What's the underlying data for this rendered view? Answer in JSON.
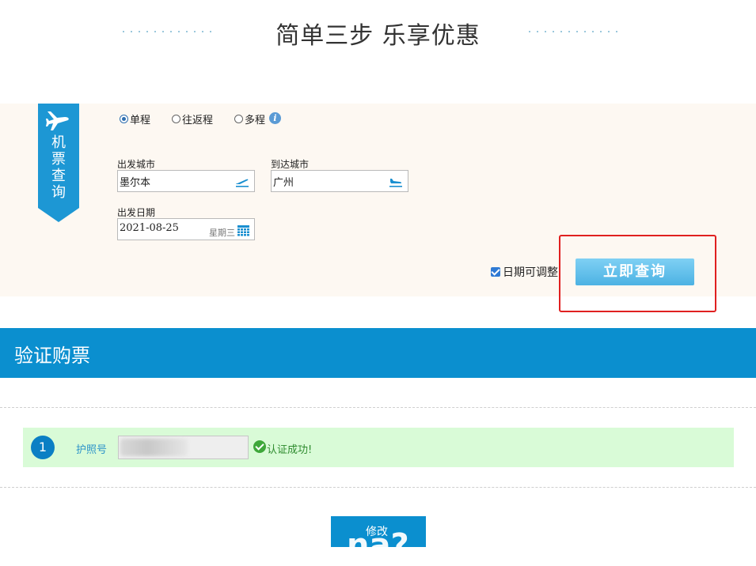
{
  "header": {
    "title": "简单三步 乐享优惠"
  },
  "flight_search": {
    "side_label": "机票查询",
    "trip_types": [
      {
        "label": "单程",
        "selected": true
      },
      {
        "label": "往返程",
        "selected": false
      },
      {
        "label": "多程",
        "selected": false
      }
    ],
    "departure_city": {
      "label": "出发城市",
      "value": "墨尔本"
    },
    "arrival_city": {
      "label": "到达城市",
      "value": "广州"
    },
    "departure_date": {
      "label": "出发日期",
      "value": "2021-08-25",
      "weekday": "星期三"
    },
    "date_adjustable": {
      "label": "日期可调整",
      "checked": true
    },
    "search_button": "立即查询"
  },
  "verify": {
    "title": "验证购票",
    "step_number": "1",
    "passport_label": "护照号",
    "status_text": "认证成功!"
  },
  "footer": {
    "modify_button": "修改",
    "modify_overlay": "na?"
  },
  "colors": {
    "primary_blue": "#0b8fcf",
    "search_button": "#4cb2e3",
    "success_green": "#3ea83a",
    "highlight_red": "#e02020",
    "panel_bg": "#fdf8f2"
  }
}
